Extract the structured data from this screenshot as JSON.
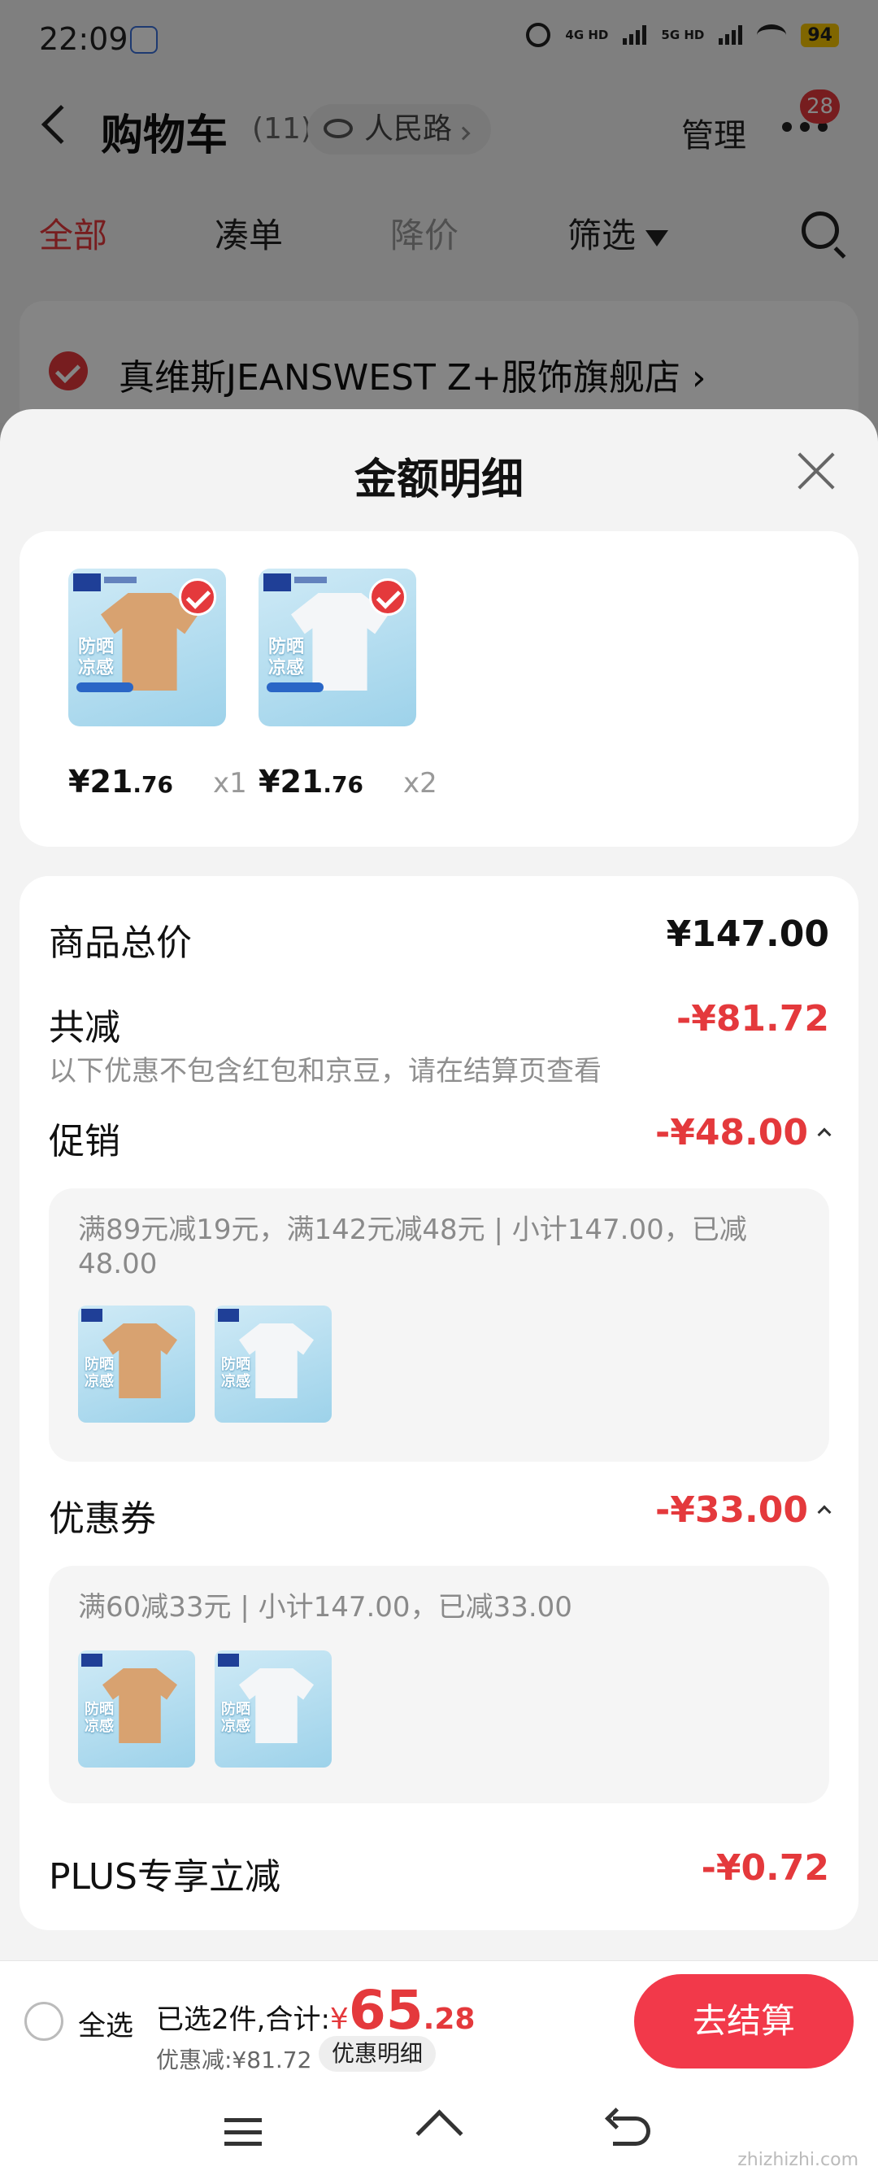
{
  "status_bar": {
    "time": "22:09",
    "network1": "4G HD",
    "network2": "5G HD",
    "battery": "94"
  },
  "nav": {
    "title": "购物车",
    "count": "(11)",
    "location": "人民路",
    "manage": "管理",
    "badge": "28"
  },
  "tabs": [
    "全部",
    "凑单",
    "降价",
    "筛选"
  ],
  "store": {
    "name": "真维斯JEANSWEST Z+服饰旗舰店 ›"
  },
  "sheet": {
    "title": "金额明细",
    "products": [
      {
        "price_int": "¥21",
        "price_dec": ".76",
        "qty": "x1",
        "color": "tan",
        "promo": "防晒\n凉感"
      },
      {
        "price_int": "¥21",
        "price_dec": ".76",
        "qty": "x2",
        "color": "white",
        "promo": "防晒\n凉感"
      }
    ],
    "total_label": "商品总价",
    "total_value": "¥147.00",
    "reduce_label": "共减",
    "reduce_value": "-¥81.72",
    "reduce_note": "以下优惠不包含红包和京豆，请在结算页查看",
    "promo_label": "促销",
    "promo_value": "-¥48.00",
    "promo_text": "满89元减19元，满142元减48元 | 小计147.00，已减48.00",
    "coupon_label": "优惠券",
    "coupon_value": "-¥33.00",
    "coupon_text": "满60减33元 | 小计147.00，已减33.00",
    "plus_label": "PLUS专享立减",
    "plus_value": "-¥0.72"
  },
  "checkout": {
    "select_all": "全选",
    "selected_text": "已选2件,合计:",
    "yen": "¥",
    "total_int": "65",
    "total_dec": ".28",
    "discount_text": "优惠减:¥81.72",
    "detail_button": "优惠明细",
    "pay_button": "去结算"
  },
  "watermark": "zhizhizhi.com",
  "colors": {
    "accent": "#e4393c",
    "pay_button": "#f2394a"
  }
}
